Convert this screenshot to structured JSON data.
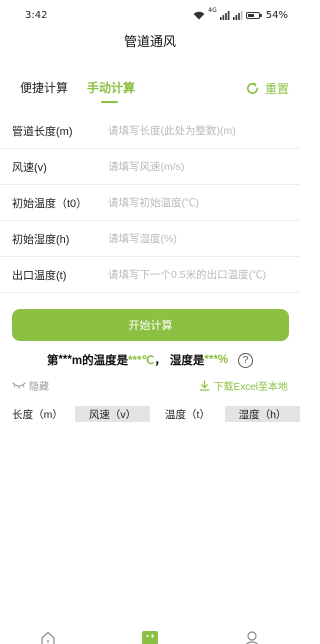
{
  "status_bar": {
    "time": "3:42",
    "signal_label": "4G",
    "battery": "54%"
  },
  "header": {
    "title": "管道通风"
  },
  "tabs": [
    {
      "label": "便捷计算",
      "active": false
    },
    {
      "label": "手动计算",
      "active": true
    }
  ],
  "reset_label": "重置",
  "form": {
    "rows": [
      {
        "label": "管道长度(m)",
        "placeholder": "请填写长度(此处为整数)(m)",
        "value": ""
      },
      {
        "label": "风速(v)",
        "placeholder": "请填写风速(m/s)",
        "value": ""
      },
      {
        "label": "初始温度（t0）",
        "placeholder": "请填写初始温度(℃)",
        "value": ""
      },
      {
        "label": "初始湿度(h)",
        "placeholder": "请填写湿度(%)",
        "value": ""
      },
      {
        "label": "出口温度(t)",
        "placeholder": "请填写下一个0.5米的出口温度(℃)",
        "value": ""
      }
    ]
  },
  "start_button_label": "开始计算",
  "result": {
    "prefix": "第",
    "m_value": "***",
    "temp_text": "m的温度是",
    "temp_value": "***℃",
    "sep": "，",
    "hum_text": "湿度是",
    "hum_value": "***%",
    "help_symbol": "?"
  },
  "hide_label": "隐藏",
  "download_label": "下载Excel至本地",
  "table": {
    "columns": [
      "长度（m）",
      "风速（v）",
      "温度（t）",
      "湿度（h）"
    ]
  },
  "colors": {
    "accent": "#8cc042",
    "placeholder": "#b9b9b9",
    "table_header_shade": "#e3e3e3"
  },
  "icons": {
    "reset": "refresh-icon",
    "hide": "eye-closed-icon",
    "download": "download-icon",
    "help": "question-icon",
    "nav_home": "home-icon",
    "nav_calc": "calculator-icon",
    "nav_profile": "user-icon"
  }
}
